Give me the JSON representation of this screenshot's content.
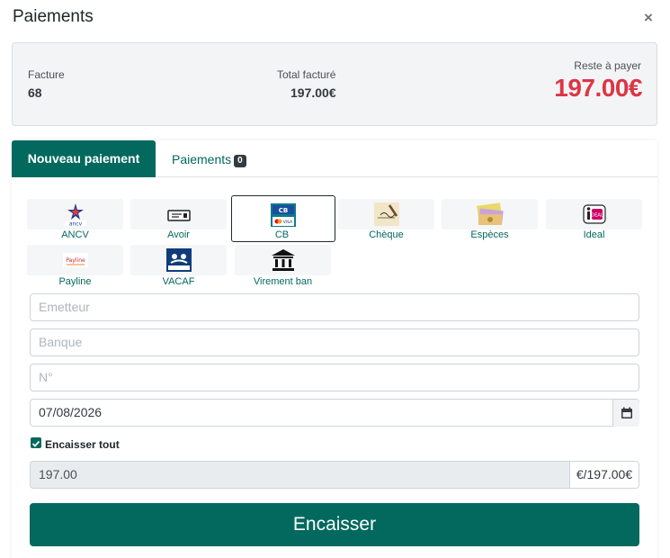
{
  "modal": {
    "title": "Paiements",
    "close": "×"
  },
  "summary": {
    "invoice_label": "Facture",
    "invoice_value": "68",
    "total_label": "Total facturé",
    "total_value": "197.00€",
    "remaining_label": "Reste à payer",
    "remaining_value": "197.00€"
  },
  "tabs": {
    "new_payment": "Nouveau paiement",
    "payments": "Paiements",
    "payments_count": "0"
  },
  "methods": [
    {
      "label": "ANCV",
      "icon": "ancv-logo-icon"
    },
    {
      "label": "Avoir",
      "icon": "ticket-icon"
    },
    {
      "label": "CB",
      "icon": "cb-card-icon",
      "selected": true
    },
    {
      "label": "Chèque",
      "icon": "cheque-icon"
    },
    {
      "label": "Espèces",
      "icon": "banknotes-icon"
    },
    {
      "label": "Ideal",
      "icon": "ideal-logo-icon"
    },
    {
      "label": "Payline",
      "icon": "payline-logo-icon"
    },
    {
      "label": "VACAF",
      "icon": "vacaf-logo-icon"
    },
    {
      "label": "Virement ban",
      "icon": "bank-icon"
    }
  ],
  "form": {
    "issuer_placeholder": "Emetteur",
    "bank_placeholder": "Banque",
    "number_placeholder": "N°",
    "date_value": "07/08/2026",
    "collect_all_label": "Encaisser tout",
    "collect_all_checked": true,
    "amount_value": "197.00",
    "amount_suffix": "€/197.00€",
    "submit_label": "Encaisser"
  },
  "colors": {
    "primary": "#03695f",
    "danger": "#dc3545"
  }
}
